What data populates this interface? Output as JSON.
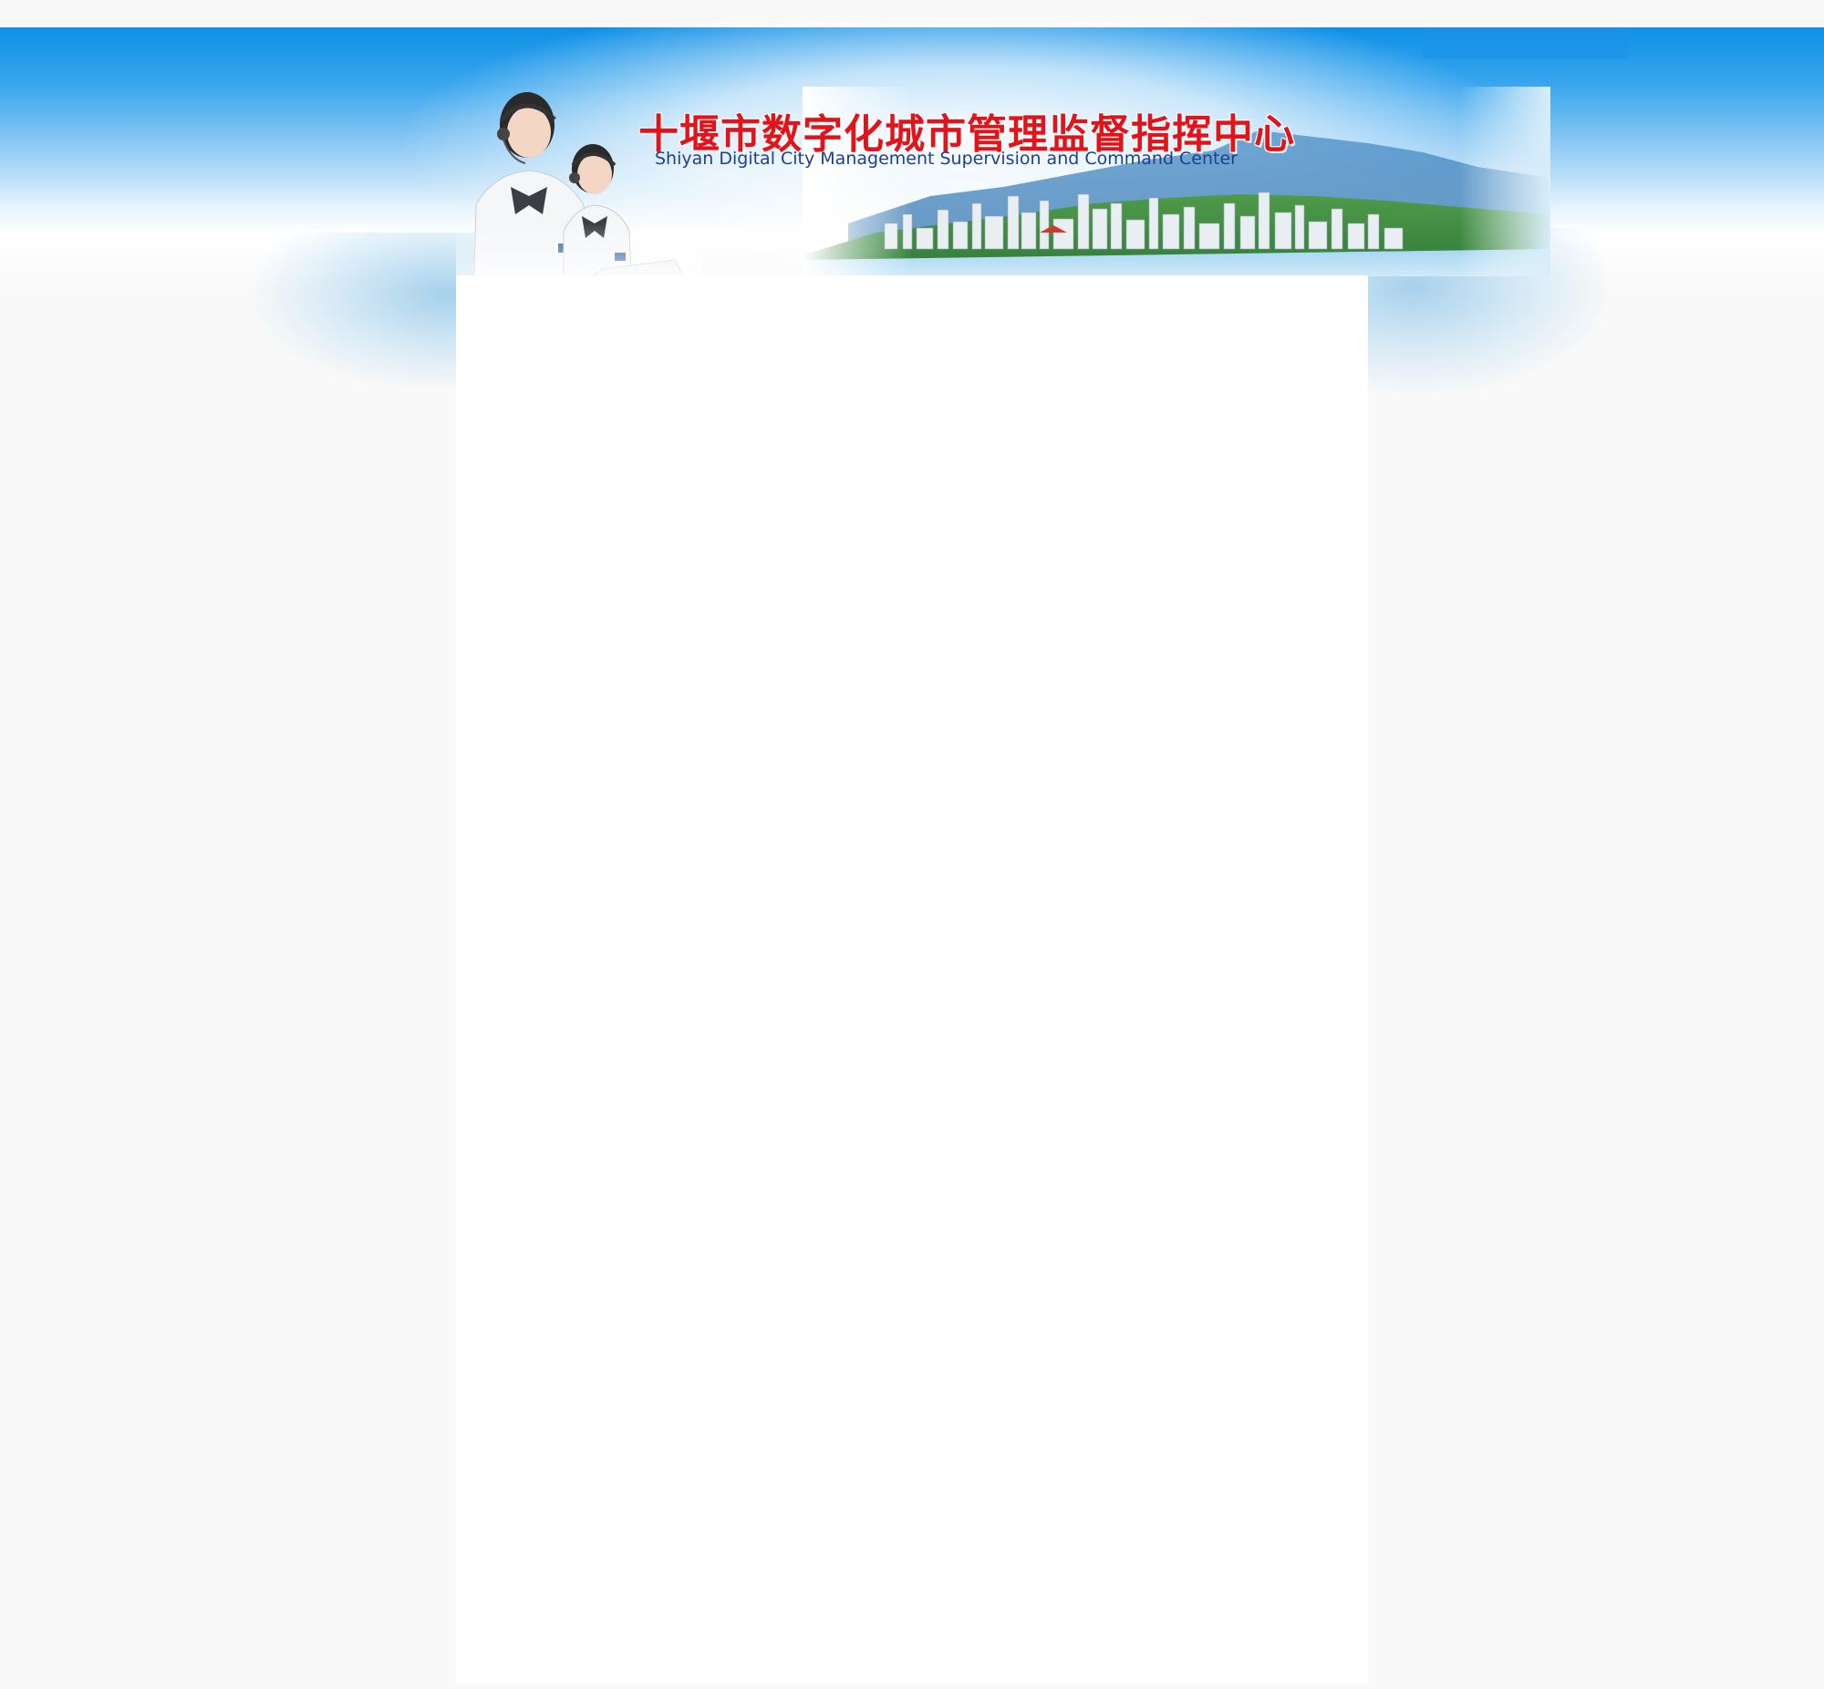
{
  "header": {
    "title_cn": "十堰市数字化城市管理监督指挥中心",
    "subtitle_en": "Shiyan Digital City Management Supervision and Command Center"
  },
  "colors": {
    "sky_blue": "#0f90e6",
    "title_red": "#e0141a",
    "subtitle_navy": "#1c3f8e",
    "page_background": "#f9f9f9",
    "content_background": "#ffffff"
  },
  "icons": {
    "banner_operators": "call-center-operators-illustration",
    "banner_city": "city-skyline-illustration"
  },
  "main": {
    "content": ""
  }
}
